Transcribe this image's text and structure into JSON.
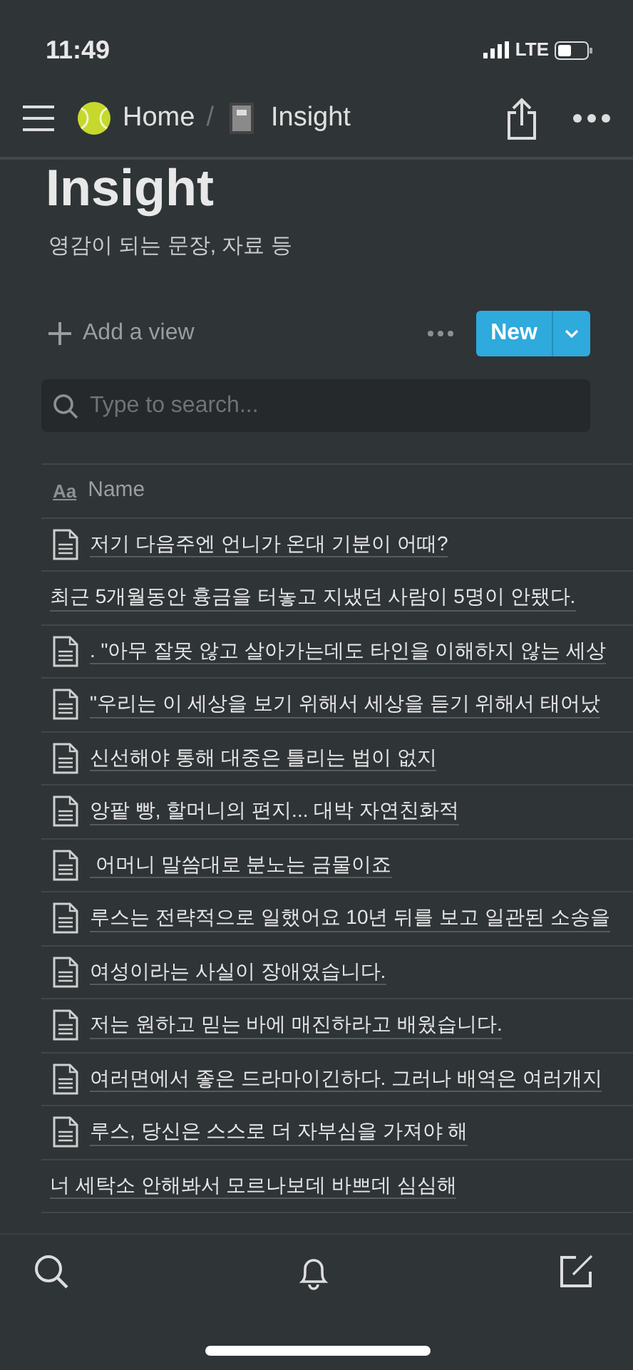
{
  "status_bar": {
    "time": "11:49",
    "network": "LTE"
  },
  "breadcrumb": [
    {
      "label": "Home",
      "kind": "ball"
    },
    {
      "label": "Insight",
      "kind": "notebook"
    }
  ],
  "breadcrumb_separator": "/",
  "page": {
    "title": "Insight",
    "description": "영감이 되는 문장, 자료 등"
  },
  "toolbar": {
    "add_view": "Add a view",
    "new_button": "New"
  },
  "search": {
    "placeholder": "Type to search..."
  },
  "table": {
    "name_column_icon": "Aa",
    "columns": [
      "Name"
    ],
    "rows": [
      {
        "kind": "page",
        "name": "저기 다음주엔 언니가 온대 기분이 어때?"
      },
      {
        "kind": "plain",
        "name": "최근 5개월동안 흉금을 터놓고 지냈던 사람이 5명이 안됐다."
      },
      {
        "kind": "page",
        "name": ". \"아무 잘못 않고 살아가는데도 타인을 이해하지 않는 세상"
      },
      {
        "kind": "page",
        "name": "\"우리는 이 세상을 보기 위해서 세상을 듣기 위해서 태어났"
      },
      {
        "kind": "page",
        "name": "신선해야 통해 대중은 틀리는 법이 없지"
      },
      {
        "kind": "page",
        "name": "앙팥 빵, 할머니의 편지... 대박 자연친화적"
      },
      {
        "kind": "page",
        "name": " 어머니 말씀대로 분노는 금물이죠"
      },
      {
        "kind": "page",
        "name": "루스는 전략적으로 일했어요 10년 뒤를 보고 일관된 소송을"
      },
      {
        "kind": "page",
        "name": "여성이라는 사실이 장애였습니다."
      },
      {
        "kind": "page",
        "name": "저는 원하고 믿는 바에 매진하라고 배웠습니다."
      },
      {
        "kind": "page",
        "name": "여러면에서 좋은 드라마이긴하다. 그러나 배역은 여러개지"
      },
      {
        "kind": "page",
        "name": "루스, 당신은 스스로 더 자부심을 가져야 해"
      },
      {
        "kind": "plain",
        "name": "너 세탁소 안해봐서 모르나보데 바쁘데 심심해"
      }
    ]
  }
}
